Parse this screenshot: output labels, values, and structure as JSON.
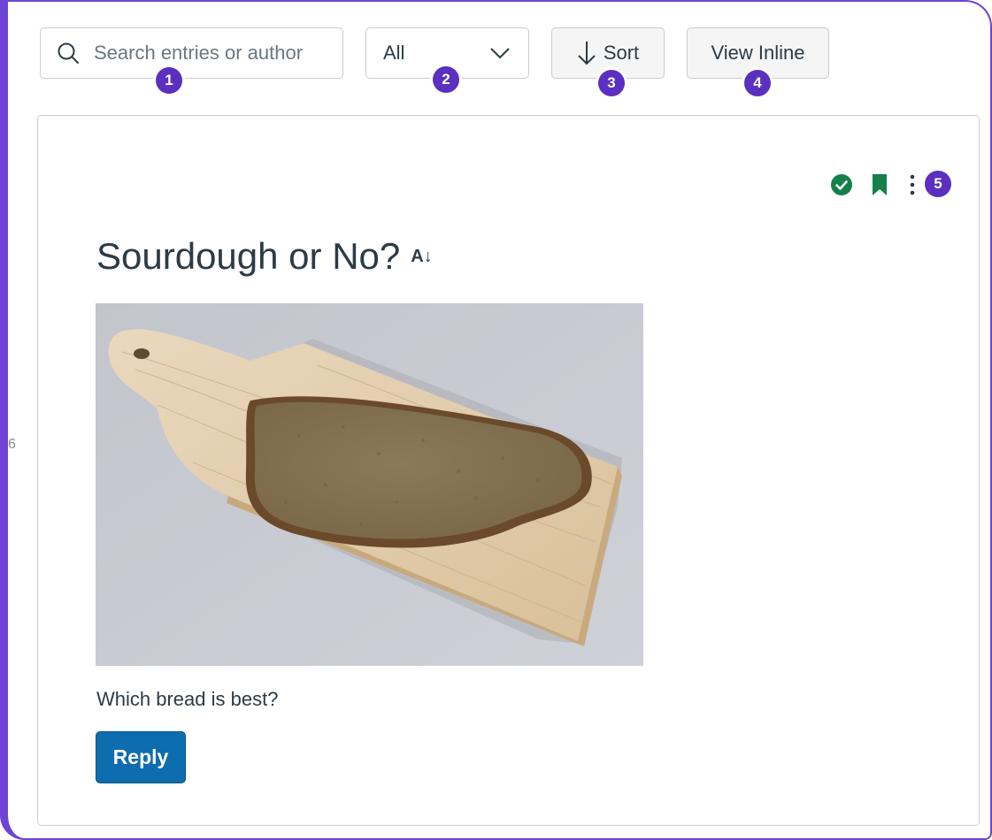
{
  "toolbar": {
    "search_placeholder": "Search entries or author",
    "filter_value": "All",
    "sort_label": "Sort",
    "view_inline_label": "View Inline"
  },
  "callouts": [
    "1",
    "2",
    "3",
    "4",
    "5"
  ],
  "post": {
    "title": "Sourdough or No?",
    "translate_icon_glyph": "A↓",
    "body": "Which bread is best?",
    "reply_label": "Reply",
    "image_alt": "slice of brown bread on a wooden cutting board"
  },
  "edge_glyph": "6",
  "colors": {
    "frame": "#6e44d4",
    "badge": "#5b2fbf",
    "reply": "#0e6dae",
    "status_green": "#14804a"
  },
  "icons": [
    "search-icon",
    "chevron-down-icon",
    "arrow-down-icon",
    "check-circle-icon",
    "bookmark-icon",
    "more-vertical-icon",
    "translate-icon"
  ]
}
